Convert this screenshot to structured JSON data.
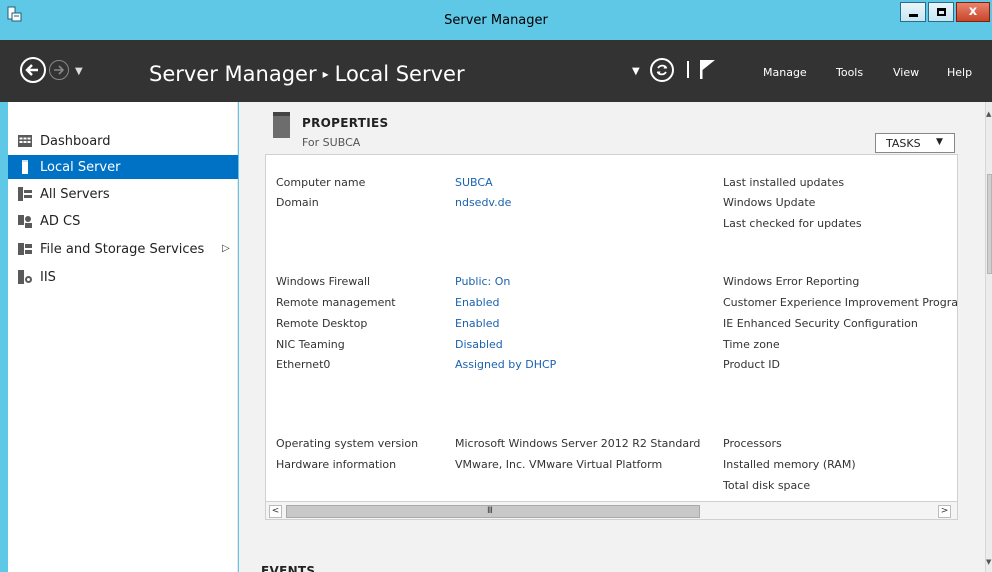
{
  "window": {
    "title": "Server Manager",
    "close_glyph": "x"
  },
  "header": {
    "breadcrumb_root": "Server Manager",
    "breadcrumb_separator": "▸",
    "breadcrumb_current": "Local Server",
    "menu": [
      "Manage",
      "Tools",
      "View",
      "Help"
    ]
  },
  "sidebar": {
    "items": [
      {
        "label": "Dashboard",
        "icon": "dashboard-icon"
      },
      {
        "label": "Local Server",
        "icon": "local-server-icon",
        "active": true
      },
      {
        "label": "All Servers",
        "icon": "all-servers-icon"
      },
      {
        "label": "AD CS",
        "icon": "ad-cs-icon"
      },
      {
        "label": "File and Storage Services",
        "icon": "file-storage-icon",
        "has_submenu": true
      },
      {
        "label": "IIS",
        "icon": "iis-icon"
      }
    ],
    "submenu_arrow": "▷"
  },
  "properties": {
    "title": "PROPERTIES",
    "subtitle": "For SUBCA",
    "tasks_label": "TASKS",
    "tasks_arrow": "▼",
    "col1": [
      {
        "label": "Computer name",
        "value": "SUBCA"
      },
      {
        "label": "Domain",
        "value": "ndsedv.de"
      },
      {
        "label": "Windows Firewall",
        "value": "Public: On"
      },
      {
        "label": "Remote management",
        "value": "Enabled"
      },
      {
        "label": "Remote Desktop",
        "value": "Enabled"
      },
      {
        "label": "NIC Teaming",
        "value": "Disabled"
      },
      {
        "label": "Ethernet0",
        "value": "Assigned by DHCP"
      },
      {
        "label": "Operating system version",
        "value": "Microsoft Windows Server 2012 R2 Standard"
      },
      {
        "label": "Hardware information",
        "value": "VMware, Inc. VMware Virtual Platform"
      }
    ],
    "col2": [
      "Last installed updates",
      "Windows Update",
      "Last checked for updates",
      "Windows Error Reporting",
      "Customer Experience Improvement Progra",
      "IE Enhanced Security Configuration",
      "Time zone",
      "Product ID",
      "Processors",
      "Installed memory (RAM)",
      "Total disk space"
    ]
  },
  "scrollbar": {
    "left_arrow": "<",
    "right_arrow": ">",
    "grip": "III"
  },
  "events": {
    "title": "EVENTS"
  },
  "colors": {
    "title_bar": "#5ec8e6",
    "header": "#333333",
    "active_item": "#0072c6",
    "link": "#1a62b0"
  }
}
